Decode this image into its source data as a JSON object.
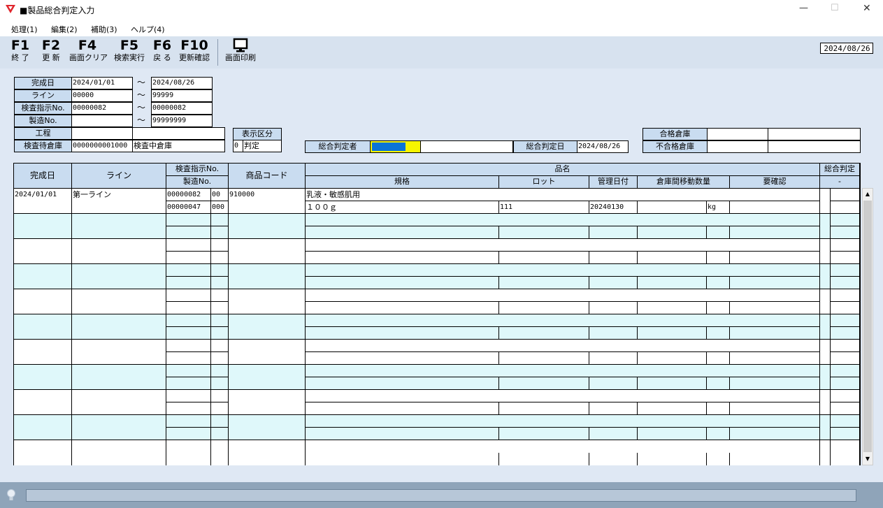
{
  "window": {
    "title": "■製品総合判定入力",
    "minimize": "—",
    "maximize": "☐",
    "close": "✕"
  },
  "menu": [
    "処理(1)",
    "編集(2)",
    "補助(3)",
    "ヘルプ(4)"
  ],
  "toolbar": [
    {
      "key": "F1",
      "label": "終 了"
    },
    {
      "key": "F2",
      "label": "更 新"
    },
    {
      "key": "F4",
      "label": "画面クリア"
    },
    {
      "key": "F5",
      "label": "検索実行"
    },
    {
      "key": "F6",
      "label": "戻 る"
    },
    {
      "key": "F10",
      "label": "更新確認"
    }
  ],
  "print": {
    "label": "画面印刷",
    "icon": "monitor-icon"
  },
  "current_date": "2024/08/26",
  "tilde": "～",
  "filters": {
    "completion_date": {
      "label": "完成日",
      "from": "2024/01/01",
      "to": "2024/08/26"
    },
    "line": {
      "label": "ライン",
      "from": "00000",
      "to": "99999"
    },
    "inspection_no": {
      "label": "検査指示No.",
      "from": "00000082",
      "to": "00000082"
    },
    "manufacture_no": {
      "label": "製造No.",
      "from": "",
      "to": "99999999"
    },
    "process": {
      "label": "工程",
      "code": "",
      "name": ""
    },
    "pending_warehouse": {
      "label": "検査待倉庫",
      "code": "0000000001000",
      "name": "検査中倉庫"
    },
    "display_type": {
      "label": "表示区分",
      "code": "0",
      "name": "判定"
    },
    "judge_person": {
      "label": "総合判定者",
      "name": ""
    },
    "judge_date": {
      "label": "総合判定日",
      "value": "2024/08/26"
    },
    "pass_warehouse": {
      "label": "合格倉庫",
      "code": "",
      "name": ""
    },
    "fail_warehouse": {
      "label": "不合格倉庫",
      "code": "",
      "name": ""
    }
  },
  "colors": {
    "accent_blue": "#0a74d8",
    "accent_yellow": "#f7f500",
    "header_bg": "#c9dcf0",
    "band_alt": "#dff8fa"
  },
  "grid": {
    "headers": {
      "completion_date": "完成日",
      "line": "ライン",
      "inspection_no": "検査指示No.",
      "manufacture_no": "製造No.",
      "product_code": "商品コード",
      "product_name": "品名",
      "spec": "規格",
      "lot": "ロット",
      "mgmt_date": "管理日付",
      "transfer_qty": "倉庫間移動数量",
      "needs_check": "要確認",
      "overall_judgment": "総合判定",
      "judgment_sub": "-"
    },
    "rows": [
      {
        "completion_date": "2024/01/01",
        "line": "第一ライン",
        "inspection_no": "00000082",
        "inspection_seq": "00",
        "manufacture_no": "00000047",
        "manufacture_seq": "000",
        "product_code": "910000",
        "product_name": "乳液・敏感肌用",
        "spec": "１００ｇ",
        "lot": "111",
        "mgmt_date": "20240130",
        "qty": "",
        "unit": "kg",
        "needs_check": "",
        "judgment": ""
      }
    ]
  }
}
